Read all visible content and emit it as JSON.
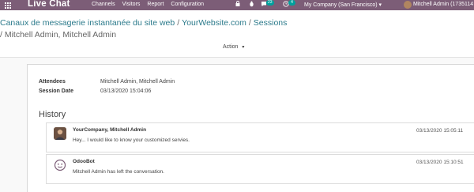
{
  "topbar": {
    "brand": "Live Chat",
    "menu": [
      "Channels",
      "Visitors",
      "Report",
      "Configuration"
    ],
    "badge_chat": "23",
    "badge_activity": "4",
    "company": "My Company (San Francisco)",
    "user": "Mitchell Admin (1735114"
  },
  "breadcrumb": {
    "item1": "Canaux de messagerie instantanée du site web",
    "item2": "YourWebsite.com",
    "item3": "Sessions",
    "sep": "/",
    "current": "Mitchell Admin, Mitchell Admin"
  },
  "action_label": "Action",
  "form": {
    "attendees_label": "Attendees",
    "attendees_value": "Mitchell Admin, Mitchell Admin",
    "session_date_label": "Session Date",
    "session_date_value": "03/13/2020 15:04:06"
  },
  "history": {
    "title": "History",
    "messages": [
      {
        "author": "YourCompany, Mitchell Admin",
        "date": "03/13/2020 15:05:11",
        "body": "Hey... I would like to know your customized servies."
      },
      {
        "author": "OdooBot",
        "date": "03/13/2020 15:10:51",
        "body": "Mitchell Admin has left the conversation."
      }
    ]
  },
  "colors": {
    "topbar": "#7c5d77",
    "link": "#2b7a8b",
    "badge": "#00a09d"
  }
}
